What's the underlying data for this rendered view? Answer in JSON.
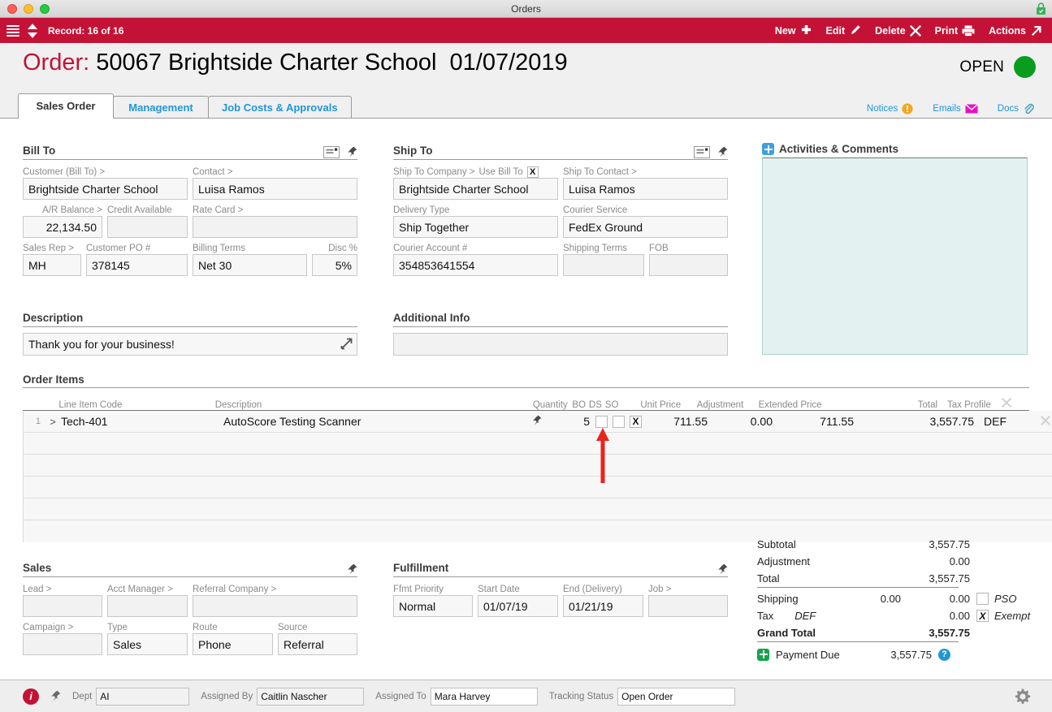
{
  "window": {
    "title": "Orders"
  },
  "toolbar": {
    "record_label": "Record: 16 of 16",
    "buttons": [
      {
        "label": "New",
        "icon": "plus-icon"
      },
      {
        "label": "Edit",
        "icon": "pencil-icon"
      },
      {
        "label": "Delete",
        "icon": "x-icon"
      },
      {
        "label": "Print",
        "icon": "printer-icon"
      },
      {
        "label": "Actions",
        "icon": "arrow-up-right-icon"
      }
    ]
  },
  "header": {
    "label": "Order:",
    "number": "50067",
    "customer": "Brightside Charter School",
    "date": "01/07/2019",
    "status_text": "OPEN",
    "status_color": "#0a9c1f"
  },
  "tabs": [
    {
      "label": "Sales Order",
      "active": true
    },
    {
      "label": "Management",
      "active": false
    },
    {
      "label": "Job Costs & Approvals",
      "active": false
    }
  ],
  "header_links": [
    {
      "label": "Notices",
      "icon": "warning-icon"
    },
    {
      "label": "Emails",
      "icon": "envelope-icon"
    },
    {
      "label": "Docs",
      "icon": "paperclip-icon"
    }
  ],
  "bill_to": {
    "title": "Bill To",
    "customer_label": "Customer (Bill To) >",
    "customer_value": "Brightside Charter School",
    "contact_label": "Contact >",
    "contact_value": "Luisa Ramos",
    "ar_balance_label": "A/R Balance >",
    "ar_balance_value": "22,134.50",
    "credit_available_label": "Credit Available",
    "credit_available_value": "",
    "rate_card_label": "Rate Card >",
    "rate_card_value": "",
    "sales_rep_label": "Sales Rep >",
    "sales_rep_value": "MH",
    "customer_po_label": "Customer PO #",
    "customer_po_value": "378145",
    "billing_terms_label": "Billing Terms",
    "billing_terms_value": "Net 30",
    "disc_label": "Disc %",
    "disc_value": "5%"
  },
  "ship_to": {
    "title": "Ship To",
    "company_label": "Ship To Company >",
    "use_bill_to_label": "Use Bill To",
    "use_bill_to_checked": "X",
    "company_value": "Brightside Charter School",
    "contact_label": "Ship To Contact >",
    "contact_value": "Luisa Ramos",
    "delivery_type_label": "Delivery Type",
    "delivery_type_value": "Ship Together",
    "courier_service_label": "Courier Service",
    "courier_service_value": "FedEx Ground",
    "courier_account_label": "Courier Account #",
    "courier_account_value": "354853641554",
    "shipping_terms_label": "Shipping Terms",
    "shipping_terms_value": "",
    "fob_label": "FOB",
    "fob_value": ""
  },
  "activities": {
    "title": "Activities & Comments",
    "content": ""
  },
  "description": {
    "title": "Description",
    "value": "Thank you for your business!"
  },
  "additional_info": {
    "title": "Additional Info",
    "value": ""
  },
  "order_items": {
    "title": "Order Items",
    "columns": {
      "line_item_code": "Line Item Code",
      "description": "Description",
      "quantity": "Quantity",
      "bo": "BO",
      "ds": "DS",
      "so": "SO",
      "unit_price": "Unit Price",
      "adjustment": "Adjustment",
      "extended_price": "Extended Price",
      "total": "Total",
      "tax_profile": "Tax Profile"
    },
    "rows": [
      {
        "num": "1",
        "expand": ">",
        "code": "Tech-401",
        "description": "AutoScore Testing Scanner",
        "quantity": "5",
        "bo": "",
        "ds": "",
        "so": "X",
        "unit_price": "711.55",
        "adjustment": "0.00",
        "extended_price": "711.55",
        "total": "3,557.75",
        "tax_profile": "DEF"
      }
    ],
    "blank_rows": 5
  },
  "sales": {
    "title": "Sales",
    "lead_label": "Lead >",
    "lead_value": "",
    "acct_manager_label": "Acct Manager >",
    "acct_manager_value": "",
    "referral_company_label": "Referral Company >",
    "referral_company_value": "",
    "campaign_label": "Campaign >",
    "campaign_value": "",
    "type_label": "Type",
    "type_value": "Sales",
    "route_label": "Route",
    "route_value": "Phone",
    "source_label": "Source",
    "source_value": "Referral"
  },
  "fulfillment": {
    "title": "Fulfillment",
    "priority_label": "Ffmt Priority",
    "priority_value": "Normal",
    "start_date_label": "Start Date",
    "start_date_value": "01/07/19",
    "end_date_label": "End (Delivery)",
    "end_date_value": "01/21/19",
    "job_label": "Job >",
    "job_value": ""
  },
  "totals": {
    "subtotal_label": "Subtotal",
    "subtotal_value": "3,557.75",
    "adjustment_label": "Adjustment",
    "adjustment_value": "0.00",
    "total_label": "Total",
    "total_value": "3,557.75",
    "shipping_label": "Shipping",
    "shipping_mid": "0.00",
    "shipping_value": "0.00",
    "pso_label": "PSO",
    "pso_checked": "",
    "tax_label": "Tax",
    "tax_profile": "DEF",
    "tax_value": "0.00",
    "exempt_label": "Exempt",
    "exempt_checked": "X",
    "grand_total_label": "Grand Total",
    "grand_total_value": "3,557.75",
    "payment_due_label": "Payment Due",
    "payment_due_value": "3,557.75"
  },
  "bottom_bar": {
    "dept_label": "Dept",
    "dept_value": "AI",
    "assigned_by_label": "Assigned By",
    "assigned_by_value": "Caitlin Nascher",
    "assigned_to_label": "Assigned To",
    "assigned_to_value": "Mara Harvey",
    "tracking_status_label": "Tracking Status",
    "tracking_status_value": "Open Order"
  },
  "annotation": {
    "type": "red-arrow",
    "points_to": "so-checkbox",
    "color": "#e8241c"
  }
}
